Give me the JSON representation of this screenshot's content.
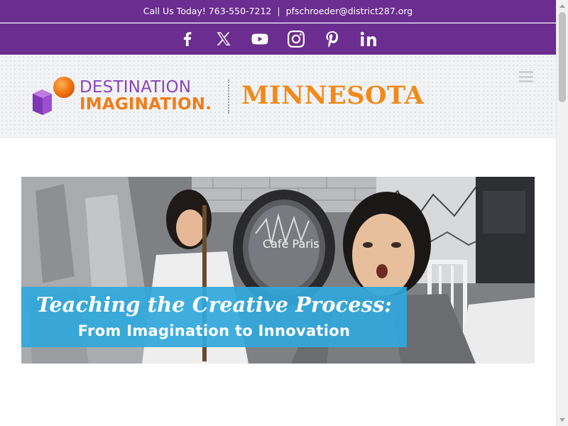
{
  "topbar": {
    "phone_text": "Call Us Today! 763-550-7212",
    "separator": "|",
    "email": "pfschroeder@district287.org"
  },
  "social": [
    {
      "name": "facebook",
      "icon": "facebook-icon"
    },
    {
      "name": "x",
      "icon": "x-twitter-icon"
    },
    {
      "name": "youtube",
      "icon": "youtube-icon"
    },
    {
      "name": "instagram",
      "icon": "instagram-icon"
    },
    {
      "name": "pinterest",
      "icon": "pinterest-icon"
    },
    {
      "name": "linkedin",
      "icon": "linkedin-icon"
    }
  ],
  "logo": {
    "line1": "DESTINATION",
    "line2": "IMAGINATION.",
    "state": "MINNESOTA"
  },
  "hero": {
    "sign_text": "Café Paris",
    "banner_line1": "Teaching the Creative Process:",
    "banner_line2": "From Imagination to Innovation"
  },
  "colors": {
    "brand_purple": "#6b2d8f",
    "brand_orange": "#f08a1a",
    "banner_blue": "#30a8dc"
  }
}
